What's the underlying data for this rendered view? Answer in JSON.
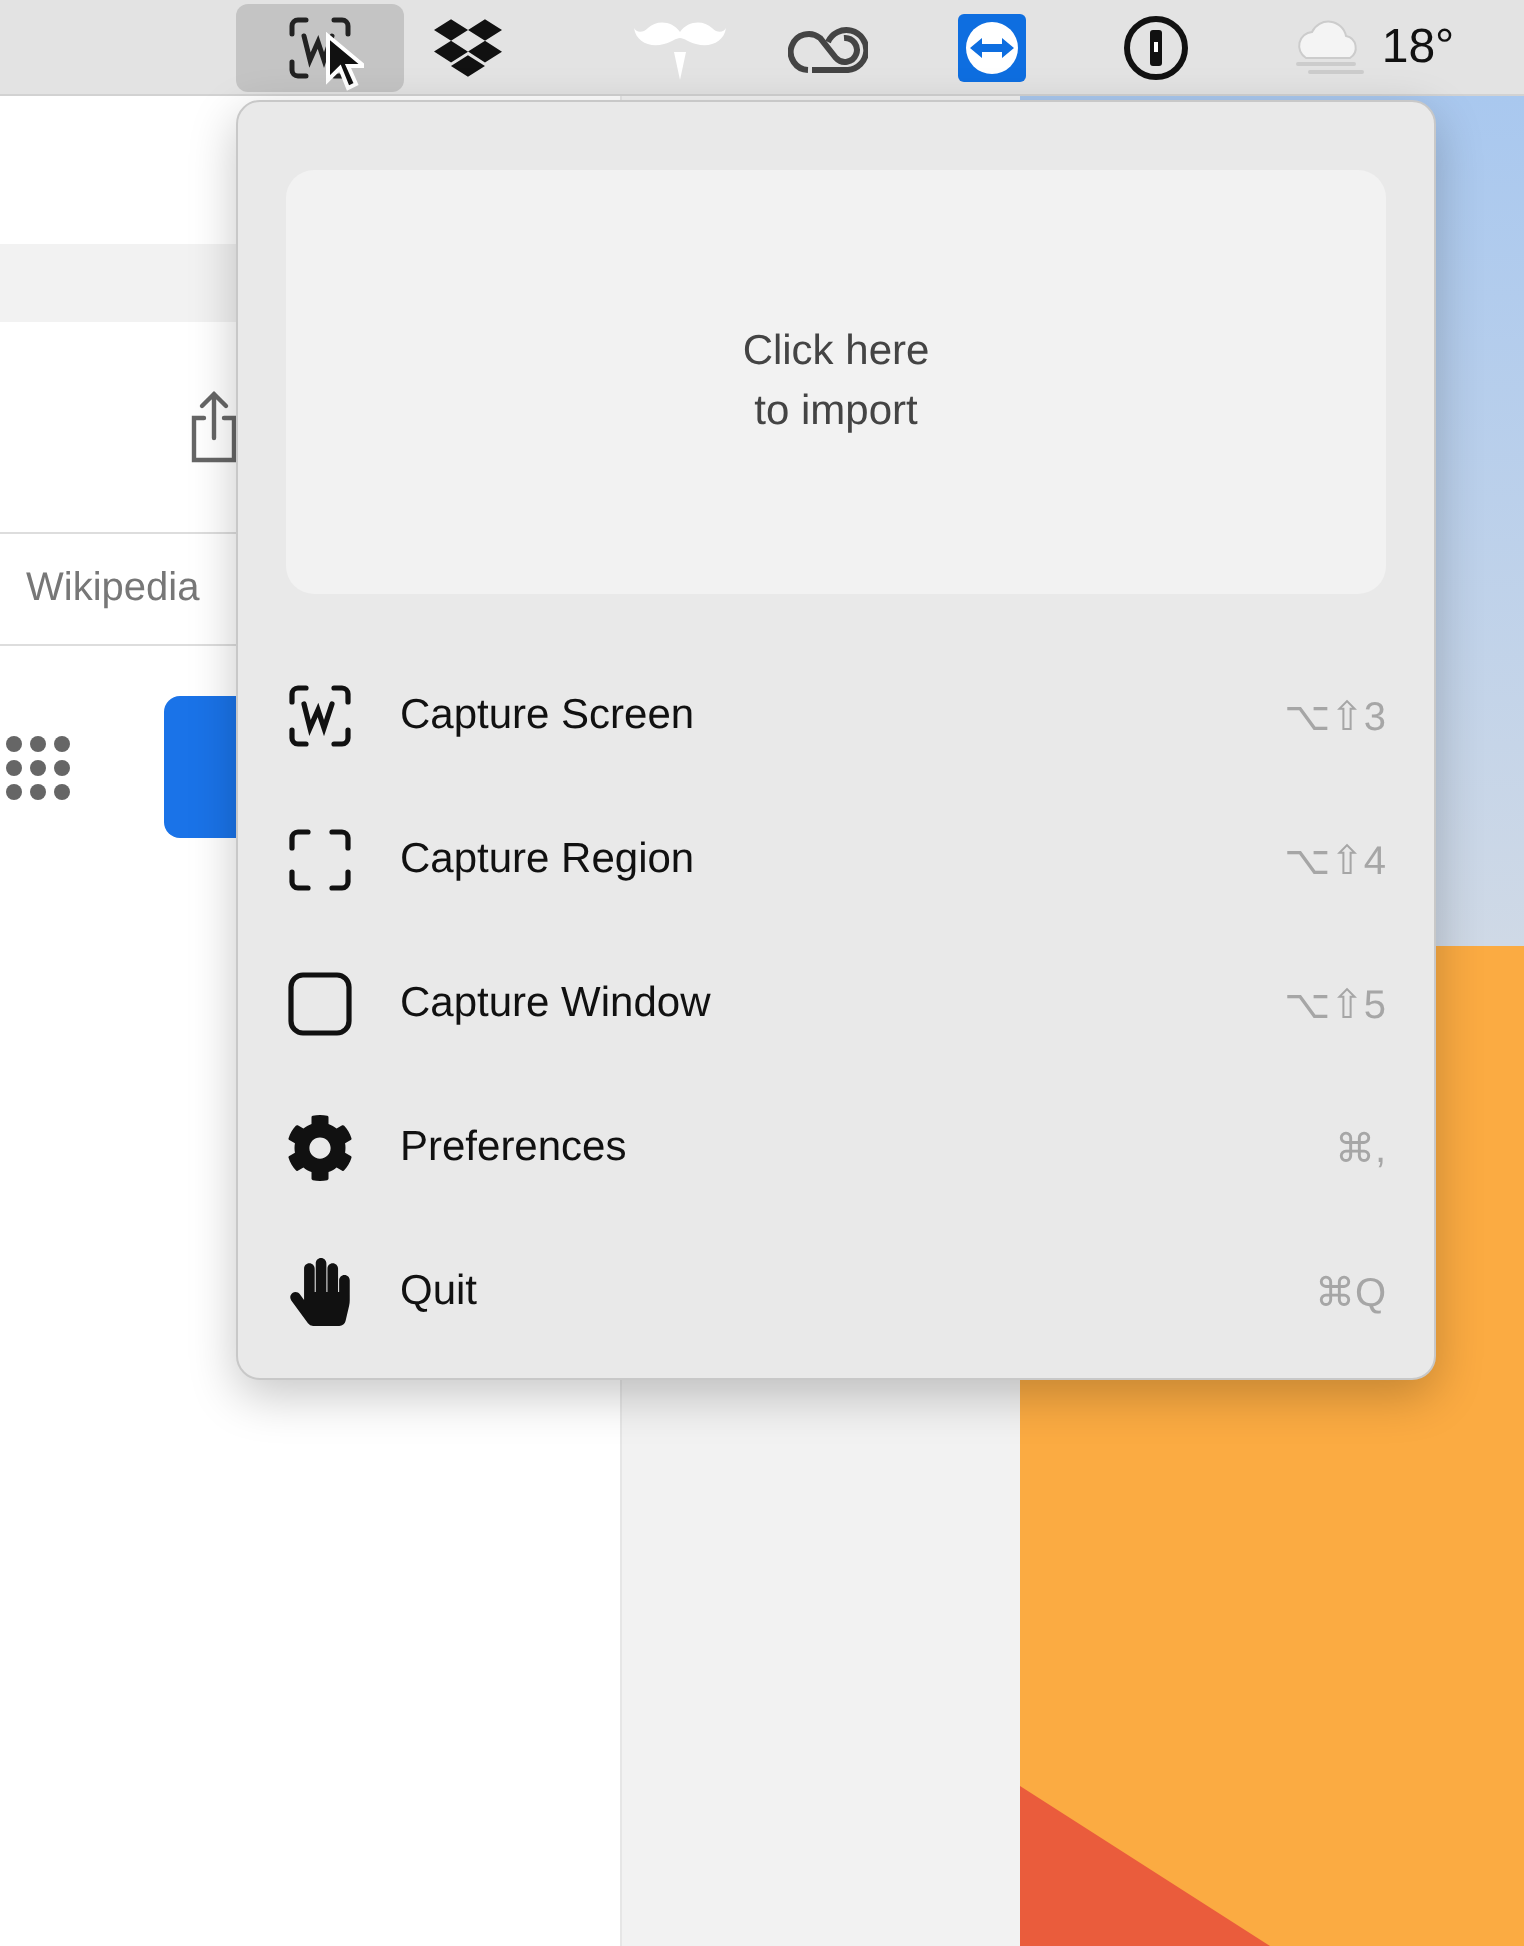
{
  "menubar": {
    "items": [
      {
        "kind": "capture",
        "selected": true
      },
      {
        "kind": "dropbox",
        "selected": false
      },
      {
        "kind": "mustache",
        "selected": false
      },
      {
        "kind": "cloud-rings",
        "selected": false
      },
      {
        "kind": "remote",
        "selected": false
      },
      {
        "kind": "keyhole",
        "selected": false
      },
      {
        "kind": "weather",
        "selected": false,
        "label": "18°"
      }
    ]
  },
  "browser": {
    "search_field": {
      "value": "Wikipedia"
    }
  },
  "menu": {
    "import_area": {
      "text": "Click here\nto import"
    },
    "items": [
      {
        "kind": "screen",
        "label": "Capture Screen",
        "shortcut": "⌥⇧3"
      },
      {
        "kind": "region",
        "label": "Capture Region",
        "shortcut": "⌥⇧4"
      },
      {
        "kind": "window",
        "label": "Capture Window",
        "shortcut": "⌥⇧5"
      },
      {
        "kind": "gear",
        "label": "Preferences",
        "shortcut": "⌘,"
      },
      {
        "kind": "hand",
        "label": "Quit",
        "shortcut": "⌘Q"
      }
    ]
  }
}
